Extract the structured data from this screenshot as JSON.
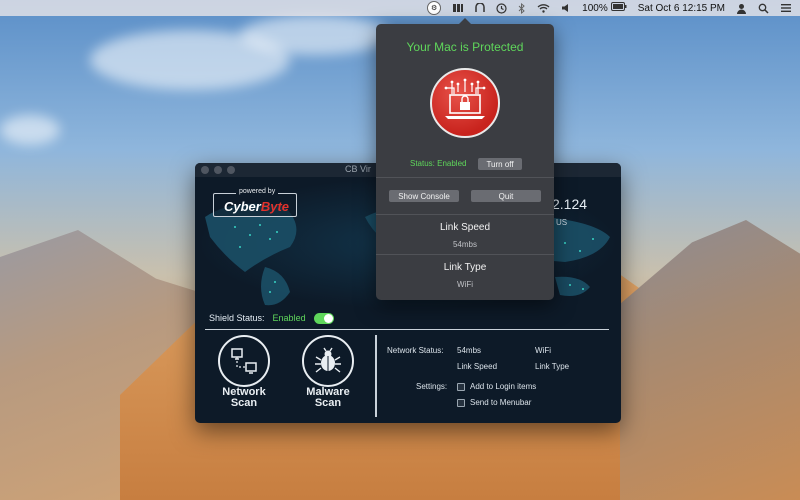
{
  "menubar": {
    "battery": "100%",
    "datetime": "Sat Oct 6  12:15 PM"
  },
  "window": {
    "title": "CB Vir",
    "brand_powered": "powered by",
    "brand_name_a": "Cyber",
    "brand_name_b": "Byte",
    "ip_fragment": "2.124",
    "loc_fragment": "US",
    "shield_label": "Shield Status:",
    "shield_value": "Enabled",
    "network_scan_line1": "Network",
    "network_scan_line2": "Scan",
    "malware_scan_line1": "Malware",
    "malware_scan_line2": "Scan",
    "network_status_label": "Network Status:",
    "link_speed_value": "54mbs",
    "link_type_value": "WiFi",
    "link_speed_label": "Link Speed",
    "link_type_label": "Link Type",
    "settings_label": "Settings:",
    "login_items_label": "Add to Login items",
    "menubar_label": "Send to Menubar"
  },
  "popover": {
    "title": "Your Mac is Protected",
    "status": "Status: Enabled",
    "turn_off": "Turn off",
    "show_console": "Show Console",
    "quit": "Quit",
    "link_speed_label": "Link Speed",
    "link_speed_value": "54mbs",
    "link_type_label": "Link Type",
    "link_type_value": "WiFi"
  },
  "colors": {
    "accent_green": "#5fd65b",
    "brand_red": "#e0322c",
    "window_bg": "#0d1a28",
    "popover_bg": "#3b3d42"
  }
}
